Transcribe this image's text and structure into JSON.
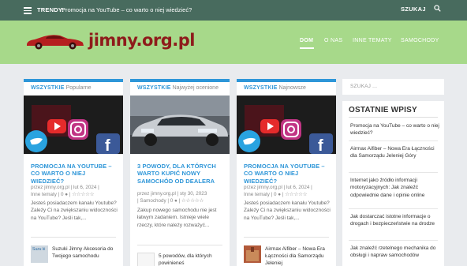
{
  "topbar": {
    "trendy_label": "TRENDY:",
    "trendy_link": "Promocja na YouTube – co warto o niej wiedzieć?",
    "search_label": "SZUKAJ"
  },
  "header": {
    "logo_text": "jimny.org.pl",
    "nav": [
      "DOM",
      "O NAS",
      "INNE TEMATY",
      "SAMOCHODY"
    ]
  },
  "columns": [
    {
      "category": "WSZYSTKIE",
      "sort": "Popularne",
      "title": "PROMOCJA NA YOUTUBE – CO WARTO O NIEJ WIEDZIEĆ?",
      "meta_line1": "przez jimny.org.pl | lut 6, 2024 |",
      "meta_line2": "Inne tematy | 0 ● | ☆☆☆☆☆",
      "excerpt": "Jesteś posiadaczem kanału Youtube? Zależy Ci na zwiększaniu widoczności na YouTube? Jeśli tak,...",
      "related_title": "Suzuki Jimny Akcesoria do Twojego samochodu",
      "related_img_alt": "Suzu ki"
    },
    {
      "category": "WSZYSTKIE",
      "sort": "Najwyżej ocenione",
      "title": "3 POWODY, DLA KTÓRYCH WARTO KUPIĆ NOWY SAMOCHÓD OD DEALERA",
      "meta_line1": "przez jimny.org.pl | sty 30, 2023",
      "meta_line2": "| Samochody | 0 ● | ☆☆☆☆☆",
      "excerpt": "Zakup nowego samochodu nie jest łatwym zadaniem. Istnieje wiele rzeczy, które należy rozważyć...",
      "related_title": "5 powodów, dla których powinieneś",
      "related_img_alt": ""
    },
    {
      "category": "WSZYSTKIE",
      "sort": "Najnowsze",
      "title": "PROMOCJA NA YOUTUBE – CO WARTO O NIEJ WIEDZIEĆ?",
      "meta_line1": "przez jimny.org.pl | lut 6, 2024 |",
      "meta_line2": "Inne tematy | 0 ● | ☆☆☆☆☆",
      "excerpt": "Jesteś posiadaczem kanału Youtube? Zależy Ci na zwiększaniu widoczności na YouTube? Jeśli tak,...",
      "related_title": "Airmax Aifiber – Nowa Era Łączności dla Samorządu Jeleniej",
      "related_img_alt": ""
    }
  ],
  "sidebar": {
    "search_placeholder": "SZUKAJ ...",
    "title": "OSTATNIE WPISY",
    "posts": [
      "Promocja na YouTube – co warto o niej wiedzieć?",
      "Airmax Aifiber – Nowa Era Łączności dla Samorządu Jeleniej Góry",
      "Internet jako źródło informacji motoryzacyjnych: Jak znaleźć odpowiednie dane i opinie online",
      "Jak dostarczać istotne informacje o drogach i bezpieczeństwie na drodze",
      "Jak znaleźć rzetelnego mechanika do obsługi i napraw samochodów"
    ]
  }
}
